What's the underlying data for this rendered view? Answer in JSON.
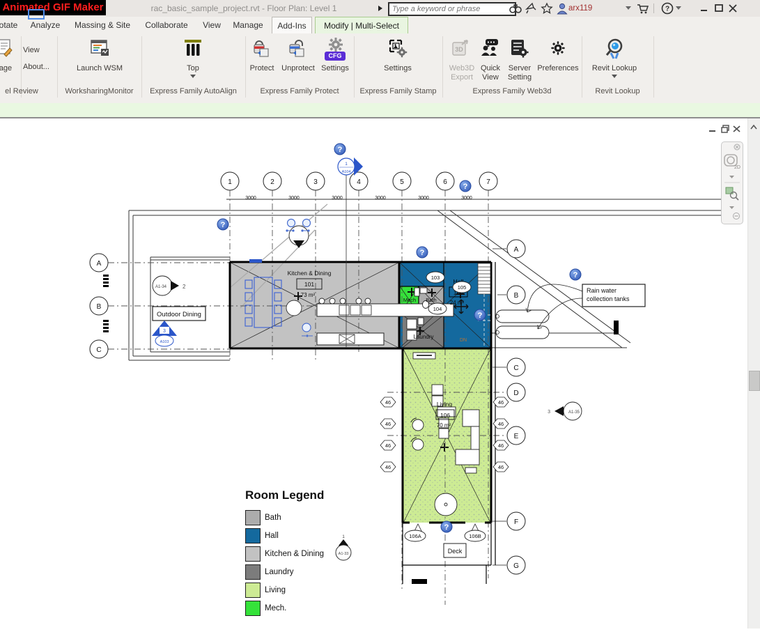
{
  "overlay": {
    "app_name": "Animated GIF Maker"
  },
  "titlebar": {
    "title": "rac_basic_sample_project.rvt - Floor Plan: Level 1",
    "search_placeholder": "Type a keyword or phrase",
    "username": "arx119"
  },
  "tabs": {
    "t0": "otate",
    "t1": "Analyze",
    "t2": "Massing & Site",
    "t3": "Collaborate",
    "t4": "View",
    "t5": "Manage",
    "t6": "Add-Ins",
    "t7": "Modify | Multi-Select"
  },
  "ribbon": {
    "partial_label": "age",
    "view": "View",
    "about": "About...",
    "launch_wsm": "Launch WSM",
    "top": "Top",
    "protect": "Protect",
    "unprotect": "Unprotect",
    "settings": "Settings",
    "cfg_badge": "CFG",
    "stamp_settings": "Settings",
    "web3d_1": "Web3D",
    "web3d_2": "Export",
    "quick_1": "Quick",
    "quick_2": "View",
    "server_1": "Server",
    "server_2": "Setting",
    "preferences": "Preferences",
    "revit_lookup": "Revit Lookup",
    "panels": {
      "review": "el Review",
      "wsm": "WorksharingMonitor",
      "autoalign": "Express Family AutoAlign",
      "protect": "Express Family Protect",
      "stamp": "Express Family Stamp",
      "web3d": "Express Family Web3d",
      "lookup": "Revit Lookup"
    }
  },
  "icons": {
    "help_glyph": "?"
  },
  "legend": {
    "title": "Room Legend",
    "items": [
      {
        "label": "Bath",
        "color": "#ACACAC"
      },
      {
        "label": "Hall",
        "color": "#14699E"
      },
      {
        "label": "Kitchen & Dining",
        "color": "#C2C2C2"
      },
      {
        "label": "Laundry",
        "color": "#7C7C7C"
      },
      {
        "label": "Living",
        "color": "#CDEB94"
      },
      {
        "label": "Mech.",
        "color": "#35E23A"
      }
    ]
  },
  "plan": {
    "grids_top": [
      "1",
      "2",
      "3",
      "4",
      "5",
      "6",
      "7"
    ],
    "grids_left": [
      "A",
      "B",
      "C"
    ],
    "grids_right": [
      "A",
      "B",
      "C",
      "D",
      "E",
      "F",
      "G"
    ],
    "dim": "3000",
    "window_tag": "46",
    "help_glyph": "?",
    "rooms": {
      "kitchen": {
        "name": "Kitchen & Dining",
        "number": "101",
        "area": "73 m²",
        "color": "#C2C2C2"
      },
      "hall": {
        "name": "Hall",
        "number": "105",
        "area": "24 m²",
        "color": "#14699E"
      },
      "mech": {
        "name": "Mech",
        "color": "#35E23A"
      },
      "bath": {
        "name": "Bath",
        "color": "#ACACAC"
      },
      "laundry": {
        "name": "Laundry",
        "color": "#7C7C7C"
      },
      "living": {
        "name": "Living",
        "number": "106",
        "area": "70 m²",
        "color": "#CDEB94"
      }
    },
    "door_tags": {
      "t103": "103",
      "t104": "104",
      "t105": "105",
      "t106a": "106A",
      "t106b": "106B"
    },
    "labels": {
      "outdoor_dining": "Outdoor Dining",
      "deck": "Deck",
      "rain_line1": "Rain water",
      "rain_line2": "collection tanks",
      "dn": "DN"
    },
    "markers": {
      "section_num": "1",
      "section_sheet": "A104",
      "callout_num": "3",
      "callout_sheet": "A103",
      "elev_left": "A1-34",
      "elev_left_ref": "2",
      "elev_bottom_num": "1",
      "elev_bottom": "A1-33",
      "elev_right": "A1-35",
      "elev_right_ref": "3"
    }
  },
  "nav": {
    "wheel_label": "2D"
  }
}
